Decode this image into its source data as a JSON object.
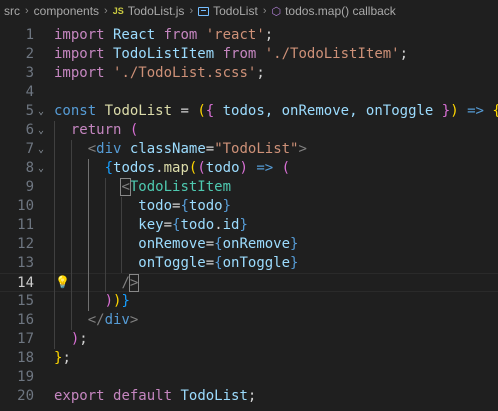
{
  "breadcrumb": {
    "items": [
      "src",
      "components",
      "TodoList.js",
      "TodoList",
      "todos.map() callback"
    ],
    "js_badge": "JS"
  },
  "editor": {
    "active_line": 14,
    "line_numbers": [
      "1",
      "2",
      "3",
      "4",
      "5",
      "6",
      "7",
      "8",
      "9",
      "10",
      "11",
      "12",
      "13",
      "14",
      "15",
      "16",
      "17",
      "18",
      "19",
      "20"
    ],
    "lines": [
      [
        [
          "import",
          "k-import"
        ],
        [
          " React ",
          "k-var"
        ],
        [
          "from",
          "k-import"
        ],
        [
          " ",
          "k-punct"
        ],
        [
          "'react'",
          "k-str"
        ],
        [
          ";",
          "k-punct"
        ]
      ],
      [
        [
          "import",
          "k-import"
        ],
        [
          " TodoListItem ",
          "k-var"
        ],
        [
          "from",
          "k-import"
        ],
        [
          " ",
          "k-punct"
        ],
        [
          "'./TodoListItem'",
          "k-str"
        ],
        [
          ";",
          "k-punct"
        ]
      ],
      [
        [
          "import",
          "k-import"
        ],
        [
          " ",
          "k-punct"
        ],
        [
          "'./TodoList.scss'",
          "k-str"
        ],
        [
          ";",
          "k-punct"
        ]
      ],
      [],
      [
        [
          "const",
          "k-kw"
        ],
        [
          " ",
          "k-punct"
        ],
        [
          "TodoList",
          "k-fn"
        ],
        [
          " = ",
          "k-punct"
        ],
        [
          "(",
          "b1"
        ],
        [
          "{",
          "b2"
        ],
        [
          " todos, onRemove, onToggle ",
          "k-var"
        ],
        [
          "}",
          "b2"
        ],
        [
          ")",
          "b1"
        ],
        [
          " => ",
          "k-kw"
        ],
        [
          "{",
          "b1"
        ]
      ],
      [
        [
          "  ",
          "k-punct"
        ],
        [
          "return",
          "k-ctrl"
        ],
        [
          " ",
          "k-punct"
        ],
        [
          "(",
          "b2"
        ]
      ],
      [
        [
          "    ",
          "k-punct"
        ],
        [
          "<",
          "k-tagpunct"
        ],
        [
          "div",
          "k-tag"
        ],
        [
          " ",
          "k-punct"
        ],
        [
          "className",
          "k-attr"
        ],
        [
          "=",
          "k-punct"
        ],
        [
          "\"TodoList\"",
          "k-str"
        ],
        [
          ">",
          "k-tagpunct"
        ]
      ],
      [
        [
          "      ",
          "k-punct"
        ],
        [
          "{",
          "b3"
        ],
        [
          "todos",
          "k-var"
        ],
        [
          ".",
          "k-punct"
        ],
        [
          "map",
          "k-fn"
        ],
        [
          "(",
          "b1"
        ],
        [
          "(",
          "b2"
        ],
        [
          "todo",
          "k-var"
        ],
        [
          ")",
          "b2"
        ],
        [
          " => ",
          "k-kw"
        ],
        [
          "(",
          "b2"
        ]
      ],
      [
        [
          "        ",
          "k-punct"
        ],
        [
          "<",
          "k-tagpunct"
        ],
        [
          "TodoListItem",
          "k-comp"
        ]
      ],
      [
        [
          "          ",
          "k-punct"
        ],
        [
          "todo",
          "k-attr"
        ],
        [
          "=",
          "k-punct"
        ],
        [
          "{",
          "k-kw"
        ],
        [
          "todo",
          "k-var"
        ],
        [
          "}",
          "k-kw"
        ]
      ],
      [
        [
          "          ",
          "k-punct"
        ],
        [
          "key",
          "k-attr"
        ],
        [
          "=",
          "k-punct"
        ],
        [
          "{",
          "k-kw"
        ],
        [
          "todo",
          "k-var"
        ],
        [
          ".",
          "k-punct"
        ],
        [
          "id",
          "k-var"
        ],
        [
          "}",
          "k-kw"
        ]
      ],
      [
        [
          "          ",
          "k-punct"
        ],
        [
          "onRemove",
          "k-attr"
        ],
        [
          "=",
          "k-punct"
        ],
        [
          "{",
          "k-kw"
        ],
        [
          "onRemove",
          "k-var"
        ],
        [
          "}",
          "k-kw"
        ]
      ],
      [
        [
          "          ",
          "k-punct"
        ],
        [
          "onToggle",
          "k-attr"
        ],
        [
          "=",
          "k-punct"
        ],
        [
          "{",
          "k-kw"
        ],
        [
          "onToggle",
          "k-var"
        ],
        [
          "}",
          "k-kw"
        ]
      ],
      [
        [
          "        ",
          "k-punct"
        ],
        [
          "/",
          "k-tagpunct"
        ],
        [
          ">",
          "k-tagpunct"
        ]
      ],
      [
        [
          "      ",
          "k-punct"
        ],
        [
          ")",
          "b2"
        ],
        [
          ")",
          "b1"
        ],
        [
          "}",
          "b3"
        ]
      ],
      [
        [
          "    ",
          "k-punct"
        ],
        [
          "</",
          "k-tagpunct"
        ],
        [
          "div",
          "k-tag"
        ],
        [
          ">",
          "k-tagpunct"
        ]
      ],
      [
        [
          "  ",
          "k-punct"
        ],
        [
          ")",
          "b2"
        ],
        [
          ";",
          "k-punct"
        ]
      ],
      [
        [
          "}",
          "b1"
        ],
        [
          ";",
          "k-punct"
        ]
      ],
      [],
      [
        [
          "export",
          "k-import"
        ],
        [
          " ",
          "k-punct"
        ],
        [
          "default",
          "k-import"
        ],
        [
          " TodoList",
          "k-var"
        ],
        [
          ";",
          "k-punct"
        ]
      ]
    ],
    "folds": {
      "5": "⌄",
      "6": "⌄",
      "7": "⌄",
      "8": "⌄"
    }
  }
}
